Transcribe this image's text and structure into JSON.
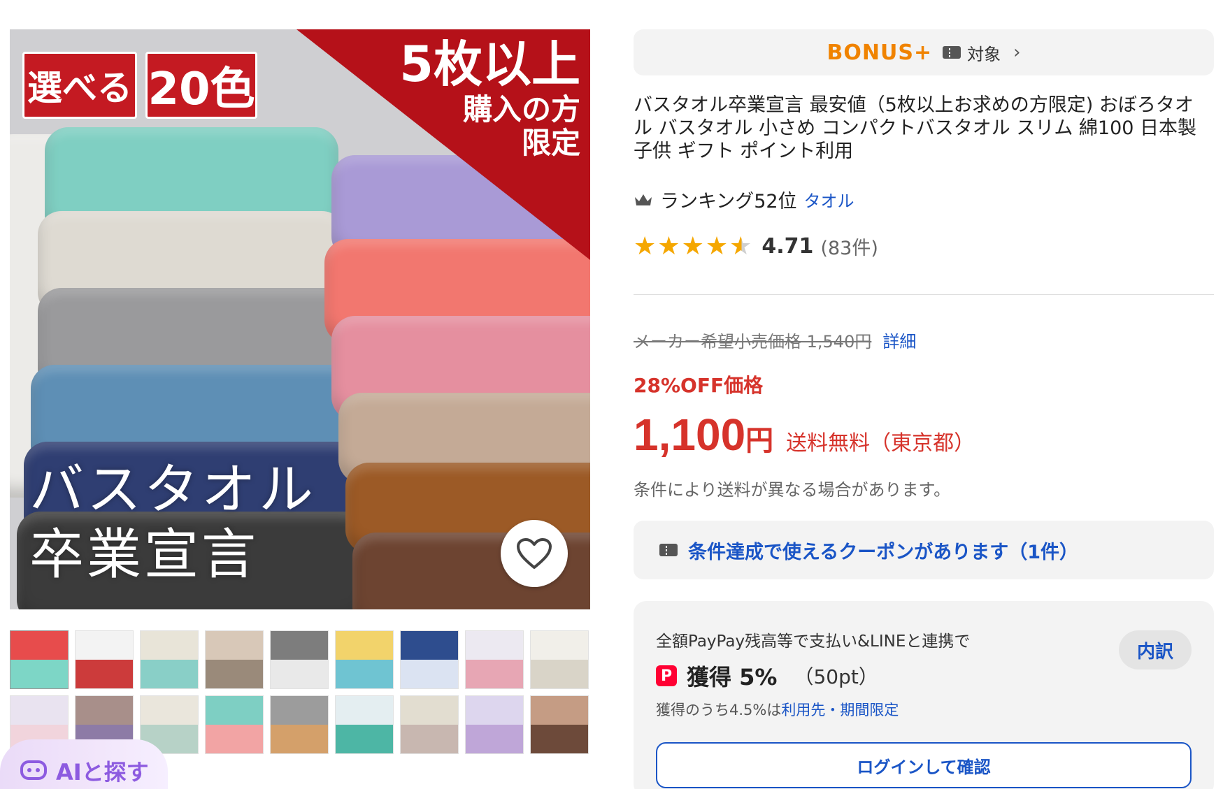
{
  "main_image": {
    "badge_left": "選べる",
    "badge_right": "20色",
    "promo_line1": "5枚以上",
    "promo_line2": "購入の方",
    "promo_line3": "限定",
    "brand_line1": "バスタオル",
    "brand_line2": "卒業宣言",
    "towel_colors": [
      "#7fcfc2",
      "#dedad2",
      "#9a9a9c",
      "#5e8fb5",
      "#2f3e72",
      "#3b3b3b",
      "#a99ad6",
      "#f2776f",
      "#e58f9f",
      "#c4aa96",
      "#9c5a26",
      "#6d4431"
    ]
  },
  "thumbnail_colors": [
    [
      "#e74c4c",
      "#7dd6c6"
    ],
    [
      "#f3f3f3",
      "#cc3b3b"
    ],
    [
      "#e8e4d8",
      "#89cfc7"
    ],
    [
      "#d8c8b8",
      "#9a8a7a"
    ],
    [
      "#7d7d7d",
      "#e9e9e9"
    ],
    [
      "#f2d36b",
      "#6fc4d2"
    ],
    [
      "#2e4d8e",
      "#dbe3f2"
    ],
    [
      "#ece9f1",
      "#e7a6b4"
    ],
    [
      "#f1efe9",
      "#d9d4c8"
    ],
    [
      "#e9e3f0",
      "#f1d4dc"
    ],
    [
      "#a88f8a",
      "#8d7ba6"
    ],
    [
      "#eae6dc",
      "#b7d2c7"
    ],
    [
      "#7ecfc3",
      "#f2a4a4"
    ],
    [
      "#9c9c9c",
      "#d4a06a"
    ],
    [
      "#e4eef1",
      "#4db6a5"
    ],
    [
      "#e2ddd0",
      "#c8b7b0"
    ],
    [
      "#ddd6ee",
      "#bfa6d8"
    ],
    [
      "#c59c84",
      "#6d4a3a"
    ]
  ],
  "ai_search_label": "AIと探す",
  "bonus": {
    "logo": "BONUS+",
    "target": "対象"
  },
  "product_title": "バスタオル卒業宣言 最安値（5枚以上お求めの方限定) おぼろタオル バスタオル 小さめ コンパクトバスタオル スリム 綿100 日本製 子供 ギフト ポイント利用",
  "ranking": {
    "text": "ランキング52位",
    "category": "タオル"
  },
  "rating": {
    "value": "4.71",
    "count": "(83件)",
    "stars": 4.71
  },
  "price": {
    "list_price": "メーカー希望小売価格 1,540円",
    "detail_link": "詳細",
    "discount": "28%OFF価格",
    "amount": "1,100",
    "currency": "円",
    "shipping": "送料無料（東京都）",
    "shipping_note": "条件により送料が異なる場合があります。"
  },
  "coupon": {
    "text": "条件達成で使えるクーポンがあります（1件）"
  },
  "paypay": {
    "description": "全額PayPay残高等で支払い&LINEと連携で",
    "earn": "獲得 5%",
    "points": "（50pt）",
    "sub_prefix": "獲得のうち4.5%は",
    "sub_link": "利用先・期間限定",
    "breakdown": "内訳",
    "login": "ログインして確認",
    "icon_letter": "P"
  }
}
